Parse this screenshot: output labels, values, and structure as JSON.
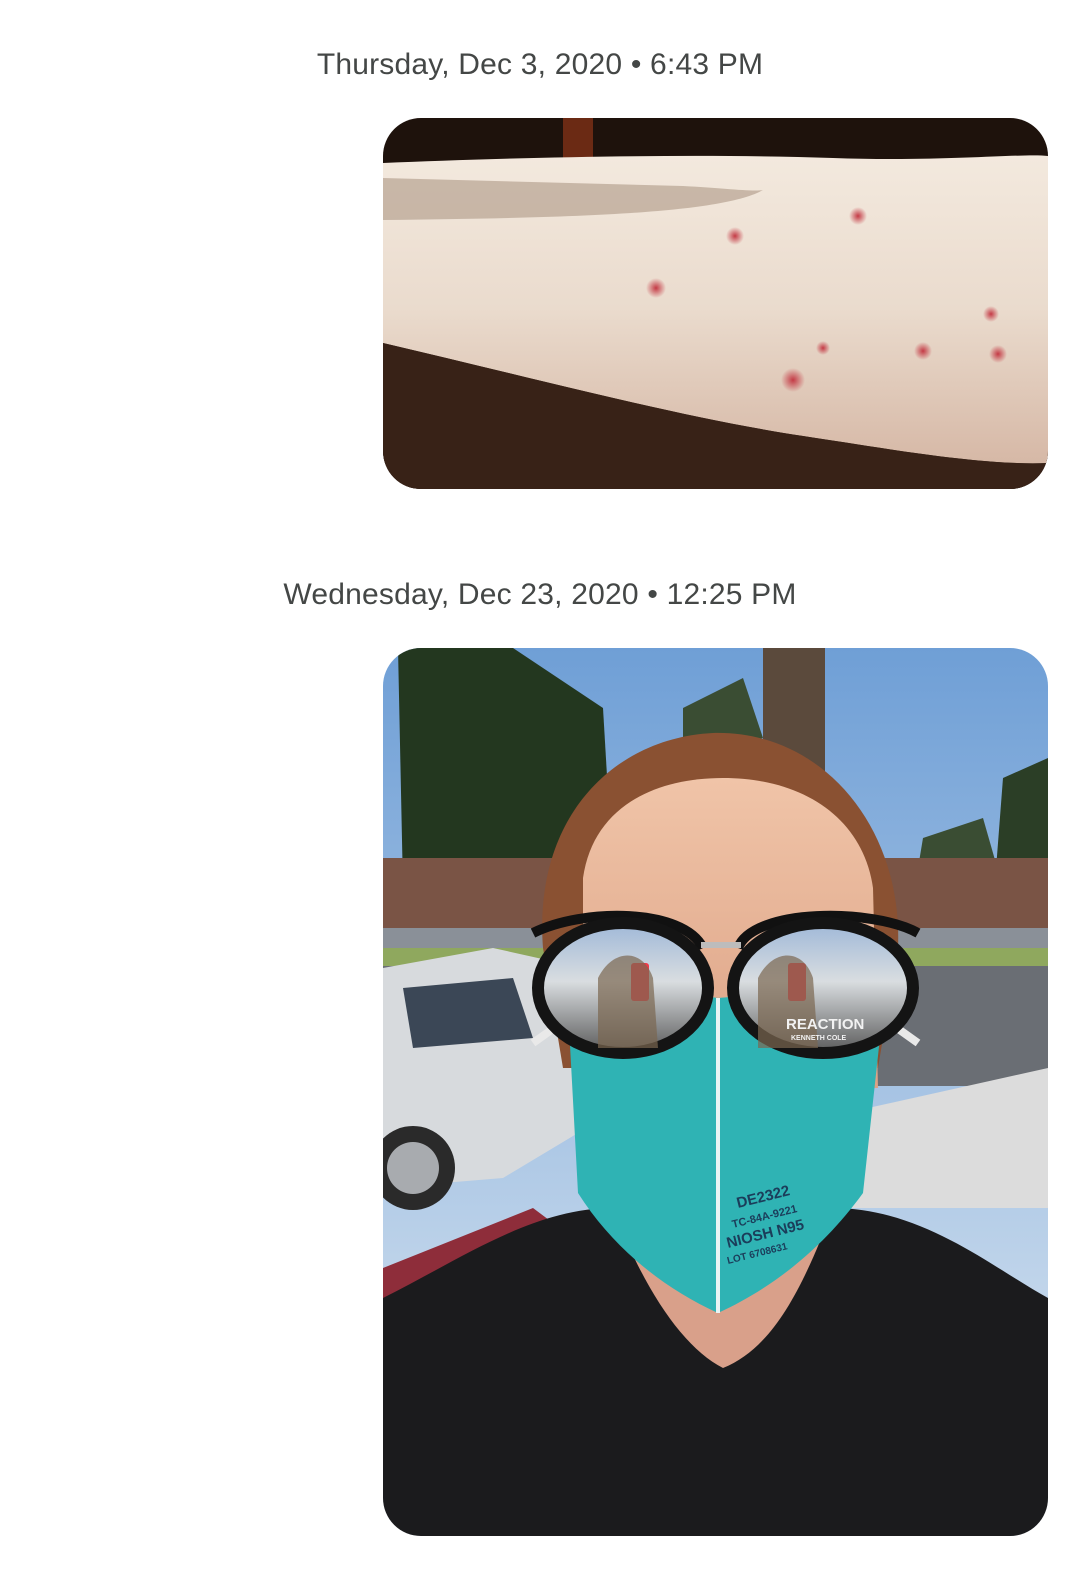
{
  "messages": [
    {
      "timestamp": "Thursday, Dec 3, 2020 • 6:43 PM",
      "attachment": {
        "type": "photo",
        "subject": "forearm-with-red-bumps"
      }
    },
    {
      "timestamp": "Wednesday, Dec 23, 2020 • 12:25 PM",
      "attachment": {
        "type": "photo",
        "subject": "selfie-with-sunglasses-and-n95-mask",
        "mask_print": [
          "DE2322",
          "TC-84A-9221",
          "NIOSH N95",
          "LOT 6708631"
        ],
        "lens_print": [
          "REACTION",
          "KENNETH COLE"
        ]
      }
    }
  ],
  "colors": {
    "timestamp_text": "#444746",
    "background": "#ffffff",
    "mask": "#2fb3b4"
  }
}
